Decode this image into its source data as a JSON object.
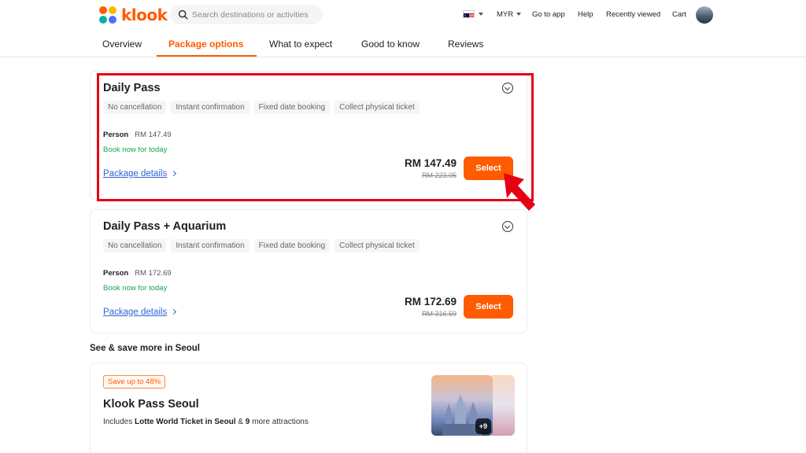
{
  "header": {
    "logo_text": "klook",
    "search_placeholder": "Search destinations or activities",
    "currency": "MYR",
    "links": [
      "Go to app",
      "Help",
      "Recently viewed",
      "Cart"
    ]
  },
  "tabs": [
    "Overview",
    "Package options",
    "What to expect",
    "Good to know",
    "Reviews"
  ],
  "packages": [
    {
      "title": "Daily Pass",
      "tags": [
        "No cancellation",
        "Instant confirmation",
        "Fixed date booking",
        "Collect physical ticket"
      ],
      "person_label": "Person",
      "person_price": "RM 147.49",
      "availability": "Book now for today",
      "details_link": "Package details",
      "price": "RM 147.49",
      "old_price": "RM 223.05",
      "select_label": "Select"
    },
    {
      "title": "Daily Pass + Aquarium",
      "tags": [
        "No cancellation",
        "Instant confirmation",
        "Fixed date booking",
        "Collect physical ticket"
      ],
      "person_label": "Person",
      "person_price": "RM 172.69",
      "availability": "Book now for today",
      "details_link": "Package details",
      "price": "RM 172.69",
      "old_price": "RM 316.59",
      "select_label": "Select"
    }
  ],
  "see_save": {
    "section_title": "See & save more in Seoul",
    "badge": "Save up to 48%",
    "title": "Klook Pass Seoul",
    "desc_prefix": "Includes ",
    "desc_bold1": "Lotte World Ticket in Seoul",
    "desc_mid": " & ",
    "desc_bold2": "9",
    "desc_suffix": " more attractions",
    "thumb_badge": "+9"
  },
  "colors": {
    "brand": "#ff5b00",
    "link": "#2f64d6",
    "success": "#16a34a",
    "highlight": "#e60012"
  }
}
